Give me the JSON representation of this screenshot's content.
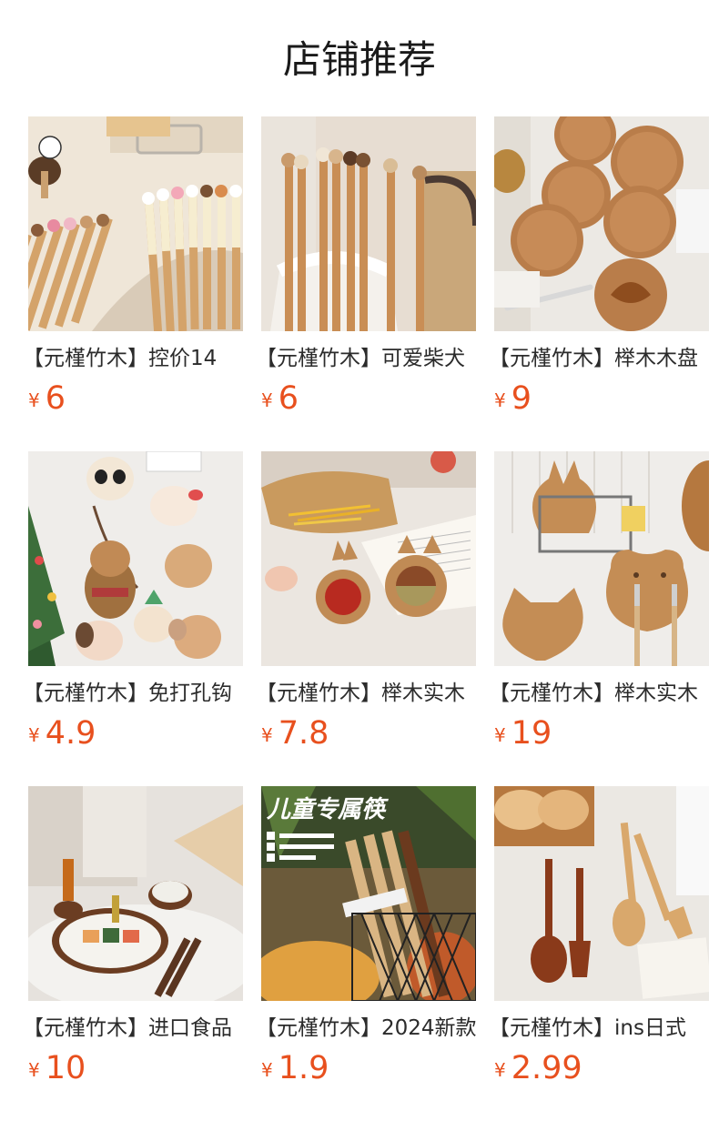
{
  "section": {
    "title": "店铺推荐"
  },
  "currency_symbol": "¥",
  "products": [
    {
      "name": "【元槿竹木】控价14",
      "price": "6",
      "image": "cartoon-chopsticks-photo"
    },
    {
      "name": "【元槿竹木】可爱柴犬",
      "price": "6",
      "image": "animal-chopsticks-photo"
    },
    {
      "name": "【元槿竹木】榉木木盘",
      "price": "9",
      "image": "engraved-wood-plates-photo"
    },
    {
      "name": "【元槿竹木】免打孔钩",
      "price": "4.9",
      "image": "cartoon-wall-hooks-photo"
    },
    {
      "name": "【元槿竹木】榉木实木",
      "price": "7.8",
      "image": "animal-sauce-dishes-photo"
    },
    {
      "name": "【元槿竹木】榉木实木",
      "price": "19",
      "image": "animal-wood-trays-photo"
    },
    {
      "name": "【元槿竹木】进口食品",
      "price": "10",
      "image": "dining-set-photo"
    },
    {
      "name": "【元槿竹木】2024新款",
      "price": "1.9",
      "image": "kids-chopsticks-photo"
    },
    {
      "name": "【元槿竹木】ins日式",
      "price": "2.99",
      "image": "wooden-spoon-fork-photo"
    }
  ],
  "overlay_texts": {
    "kids_banner": "儿童专属筷"
  }
}
